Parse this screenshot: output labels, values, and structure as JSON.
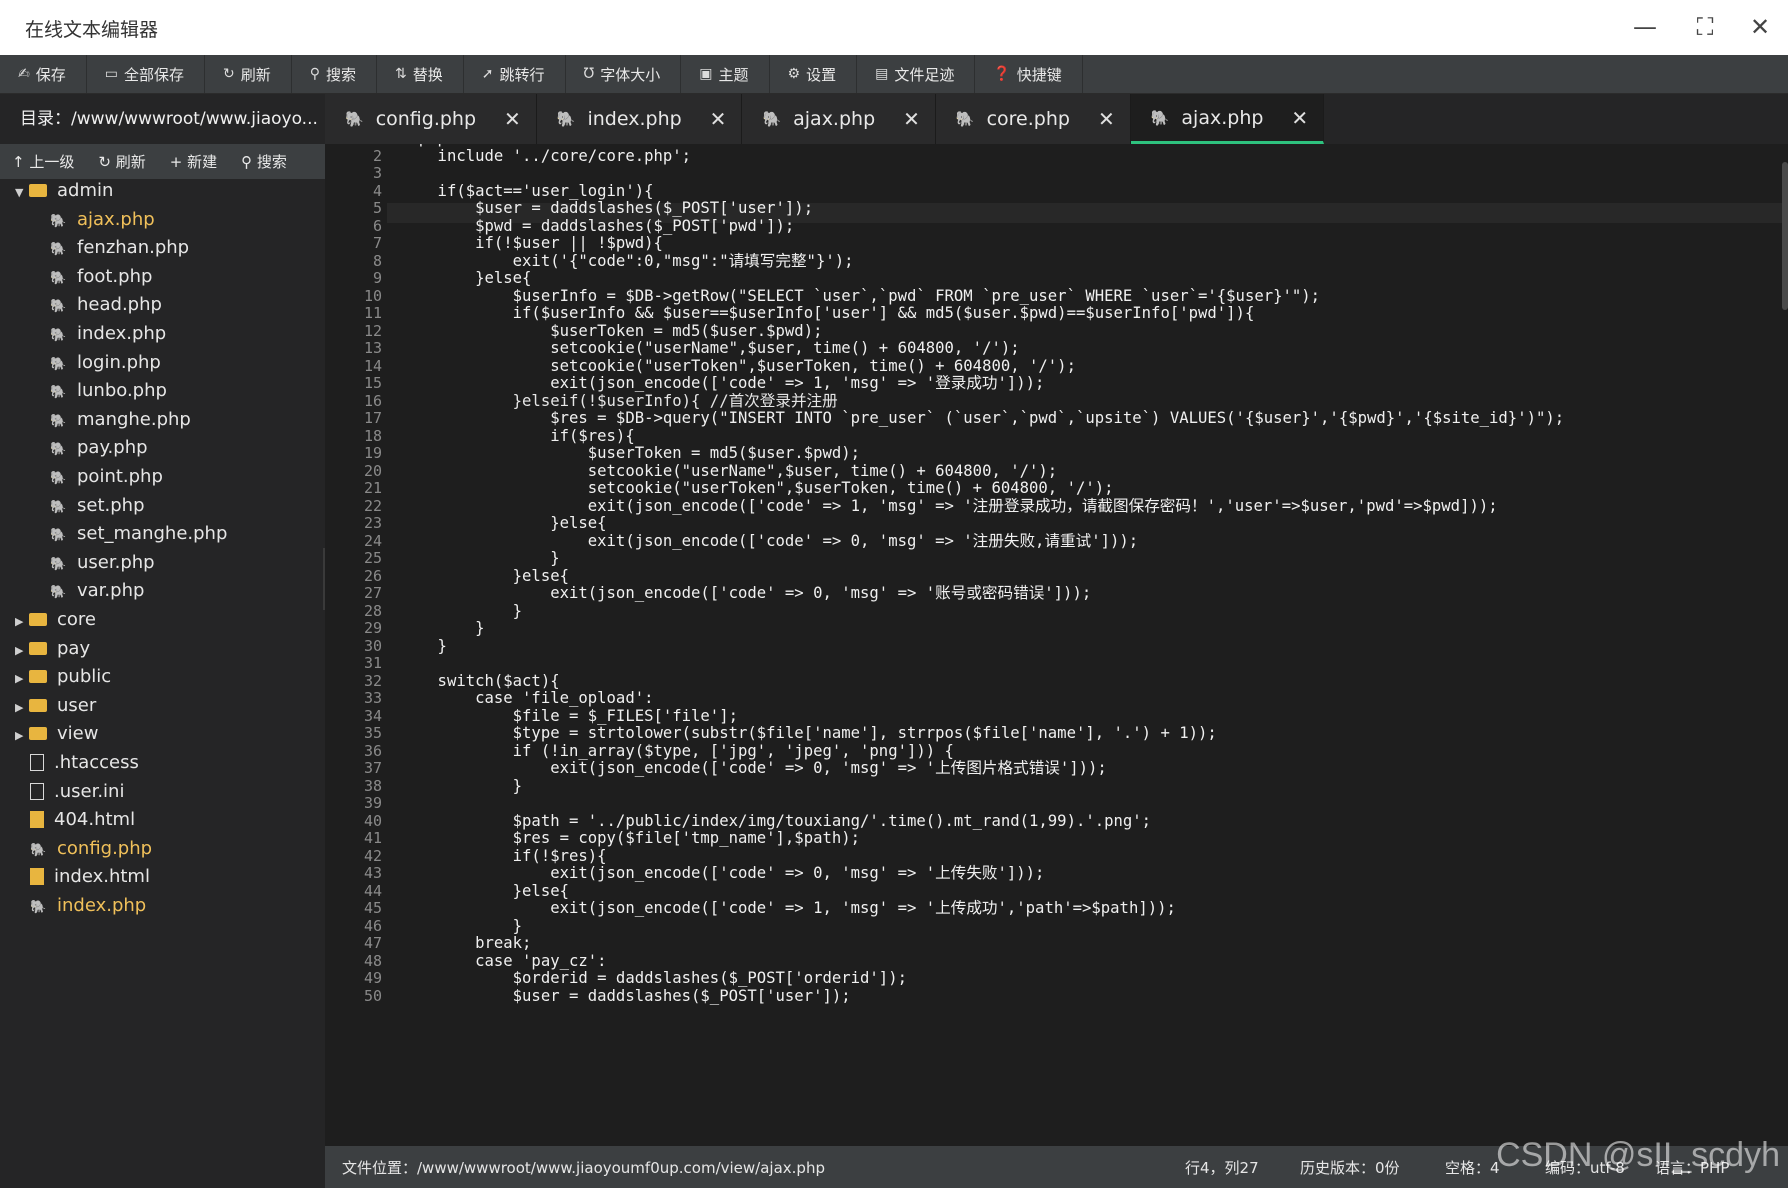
{
  "window": {
    "title": "在线文本编辑器"
  },
  "toolbar": [
    {
      "label": "保存",
      "icon": "save-icon"
    },
    {
      "label": "全部保存",
      "icon": "save-all-icon"
    },
    {
      "label": "刷新",
      "icon": "refresh-icon"
    },
    {
      "label": "搜索",
      "icon": "search-icon"
    },
    {
      "label": "替换",
      "icon": "replace-icon"
    },
    {
      "label": "跳转行",
      "icon": "goto-line-icon"
    },
    {
      "label": "字体大小",
      "icon": "font-size-icon"
    },
    {
      "label": "主题",
      "icon": "theme-icon"
    },
    {
      "label": "设置",
      "icon": "gear-icon"
    },
    {
      "label": "文件足迹",
      "icon": "history-icon"
    },
    {
      "label": "快捷键",
      "icon": "help-icon"
    }
  ],
  "directory": {
    "label": "目录：/www/wwwroot/www.jiaoyo..."
  },
  "side_actions": [
    {
      "label": "上一级",
      "icon": "up-arrow-icon"
    },
    {
      "label": "刷新",
      "icon": "refresh-icon"
    },
    {
      "label": "新建",
      "icon": "plus-icon"
    },
    {
      "label": "搜索",
      "icon": "search-icon"
    }
  ],
  "tabs": [
    {
      "label": "config.php",
      "active": false
    },
    {
      "label": "index.php",
      "active": false
    },
    {
      "label": "ajax.php",
      "active": false
    },
    {
      "label": "core.php",
      "active": false
    },
    {
      "label": "ajax.php",
      "active": true
    }
  ],
  "tree": [
    {
      "type": "folder",
      "label": "admin",
      "expanded": true,
      "depth": 0
    },
    {
      "type": "php",
      "label": "ajax.php",
      "depth": 1,
      "highlight": true
    },
    {
      "type": "php",
      "label": "fenzhan.php",
      "depth": 1
    },
    {
      "type": "php",
      "label": "foot.php",
      "depth": 1
    },
    {
      "type": "php",
      "label": "head.php",
      "depth": 1
    },
    {
      "type": "php",
      "label": "index.php",
      "depth": 1
    },
    {
      "type": "php",
      "label": "login.php",
      "depth": 1
    },
    {
      "type": "php",
      "label": "lunbo.php",
      "depth": 1
    },
    {
      "type": "php",
      "label": "manghe.php",
      "depth": 1
    },
    {
      "type": "php",
      "label": "pay.php",
      "depth": 1
    },
    {
      "type": "php",
      "label": "point.php",
      "depth": 1
    },
    {
      "type": "php",
      "label": "set.php",
      "depth": 1
    },
    {
      "type": "php",
      "label": "set_manghe.php",
      "depth": 1
    },
    {
      "type": "php",
      "label": "user.php",
      "depth": 1
    },
    {
      "type": "php",
      "label": "var.php",
      "depth": 1
    },
    {
      "type": "folder",
      "label": "core",
      "expanded": false,
      "depth": 0
    },
    {
      "type": "folder",
      "label": "pay",
      "expanded": false,
      "depth": 0
    },
    {
      "type": "folder",
      "label": "public",
      "expanded": false,
      "depth": 0
    },
    {
      "type": "folder",
      "label": "user",
      "expanded": false,
      "depth": 0
    },
    {
      "type": "folder",
      "label": "view",
      "expanded": false,
      "depth": 0
    },
    {
      "type": "file",
      "label": ".htaccess",
      "depth": 0
    },
    {
      "type": "file",
      "label": ".user.ini",
      "depth": 0
    },
    {
      "type": "html",
      "label": "404.html",
      "depth": 0
    },
    {
      "type": "php",
      "label": "config.php",
      "depth": 0,
      "highlight": true
    },
    {
      "type": "html",
      "label": "index.html",
      "depth": 0
    },
    {
      "type": "php",
      "label": "index.php",
      "depth": 0,
      "highlight": true
    }
  ],
  "code": [
    "<?php",
    "    include '../core/core.php';",
    "",
    "    if($act=='user_login'){",
    "        $user = daddslashes($_POST['user']);",
    "        $pwd = daddslashes($_POST['pwd']);",
    "        if(!$user || !$pwd){",
    "            exit('{\"code\":0,\"msg\":\"请填写完整\"}');",
    "        }else{",
    "            $userInfo = $DB->getRow(\"SELECT `user`,`pwd` FROM `pre_user` WHERE `user`='{$user}'\");",
    "            if($userInfo && $user==$userInfo['user'] && md5($user.$pwd)==$userInfo['pwd']){",
    "                $userToken = md5($user.$pwd);",
    "                setcookie(\"userName\",$user, time() + 604800, '/');",
    "                setcookie(\"userToken\",$userToken, time() + 604800, '/');",
    "                exit(json_encode(['code' => 1, 'msg' => '登录成功']));",
    "            }elseif(!$userInfo){ //首次登录并注册",
    "                $res = $DB->query(\"INSERT INTO `pre_user` (`user`,`pwd`,`upsite`) VALUES('{$user}','{$pwd}','{$site_id}')\");",
    "                if($res){",
    "                    $userToken = md5($user.$pwd);",
    "                    setcookie(\"userName\",$user, time() + 604800, '/');",
    "                    setcookie(\"userToken\",$userToken, time() + 604800, '/');",
    "                    exit(json_encode(['code' => 1, 'msg' => '注册登录成功，请截图保存密码！','user'=>$user,'pwd'=>$pwd]));",
    "                }else{",
    "                    exit(json_encode(['code' => 0, 'msg' => '注册失败,请重试']));",
    "                }",
    "            }else{",
    "                exit(json_encode(['code' => 0, 'msg' => '账号或密码错误']));",
    "            }",
    "        }",
    "    }",
    "",
    "    switch($act){",
    "        case 'file_opload':",
    "            $file = $_FILES['file'];",
    "            $type = strtolower(substr($file['name'], strrpos($file['name'], '.') + 1));",
    "            if (!in_array($type, ['jpg', 'jpeg', 'png'])) {",
    "                exit(json_encode(['code' => 0, 'msg' => '上传图片格式错误']));",
    "            }",
    "",
    "            $path = '../public/index/img/touxiang/'.time().mt_rand(1,99).'.png';",
    "            $res = copy($file['tmp_name'],$path);",
    "            if(!$res){",
    "                exit(json_encode(['code' => 0, 'msg' => '上传失败']));",
    "            }else{",
    "                exit(json_encode(['code' => 1, 'msg' => '上传成功','path'=>$path]));",
    "            }",
    "        break;",
    "        case 'pay_cz':",
    "            $orderid = daddslashes($_POST['orderid']);",
    "            $user = daddslashes($_POST['user']);"
  ],
  "status": {
    "path": "文件位置：/www/wwwroot/www.jiaoyoumf0up.com/view/ajax.php",
    "position": "行4，列27",
    "history": "历史版本：0份",
    "indent": "空格：4",
    "encoding": "编码：utf-8",
    "language": "语言：PHP"
  },
  "watermark": "CSDN @sII_scdyh",
  "colors": {
    "accent": "#2ec27e",
    "toolbar": "#3c3f41",
    "editor_bg": "#1e1e1e",
    "php_icon": "#6f8fc9",
    "folder": "#e8b53f"
  }
}
